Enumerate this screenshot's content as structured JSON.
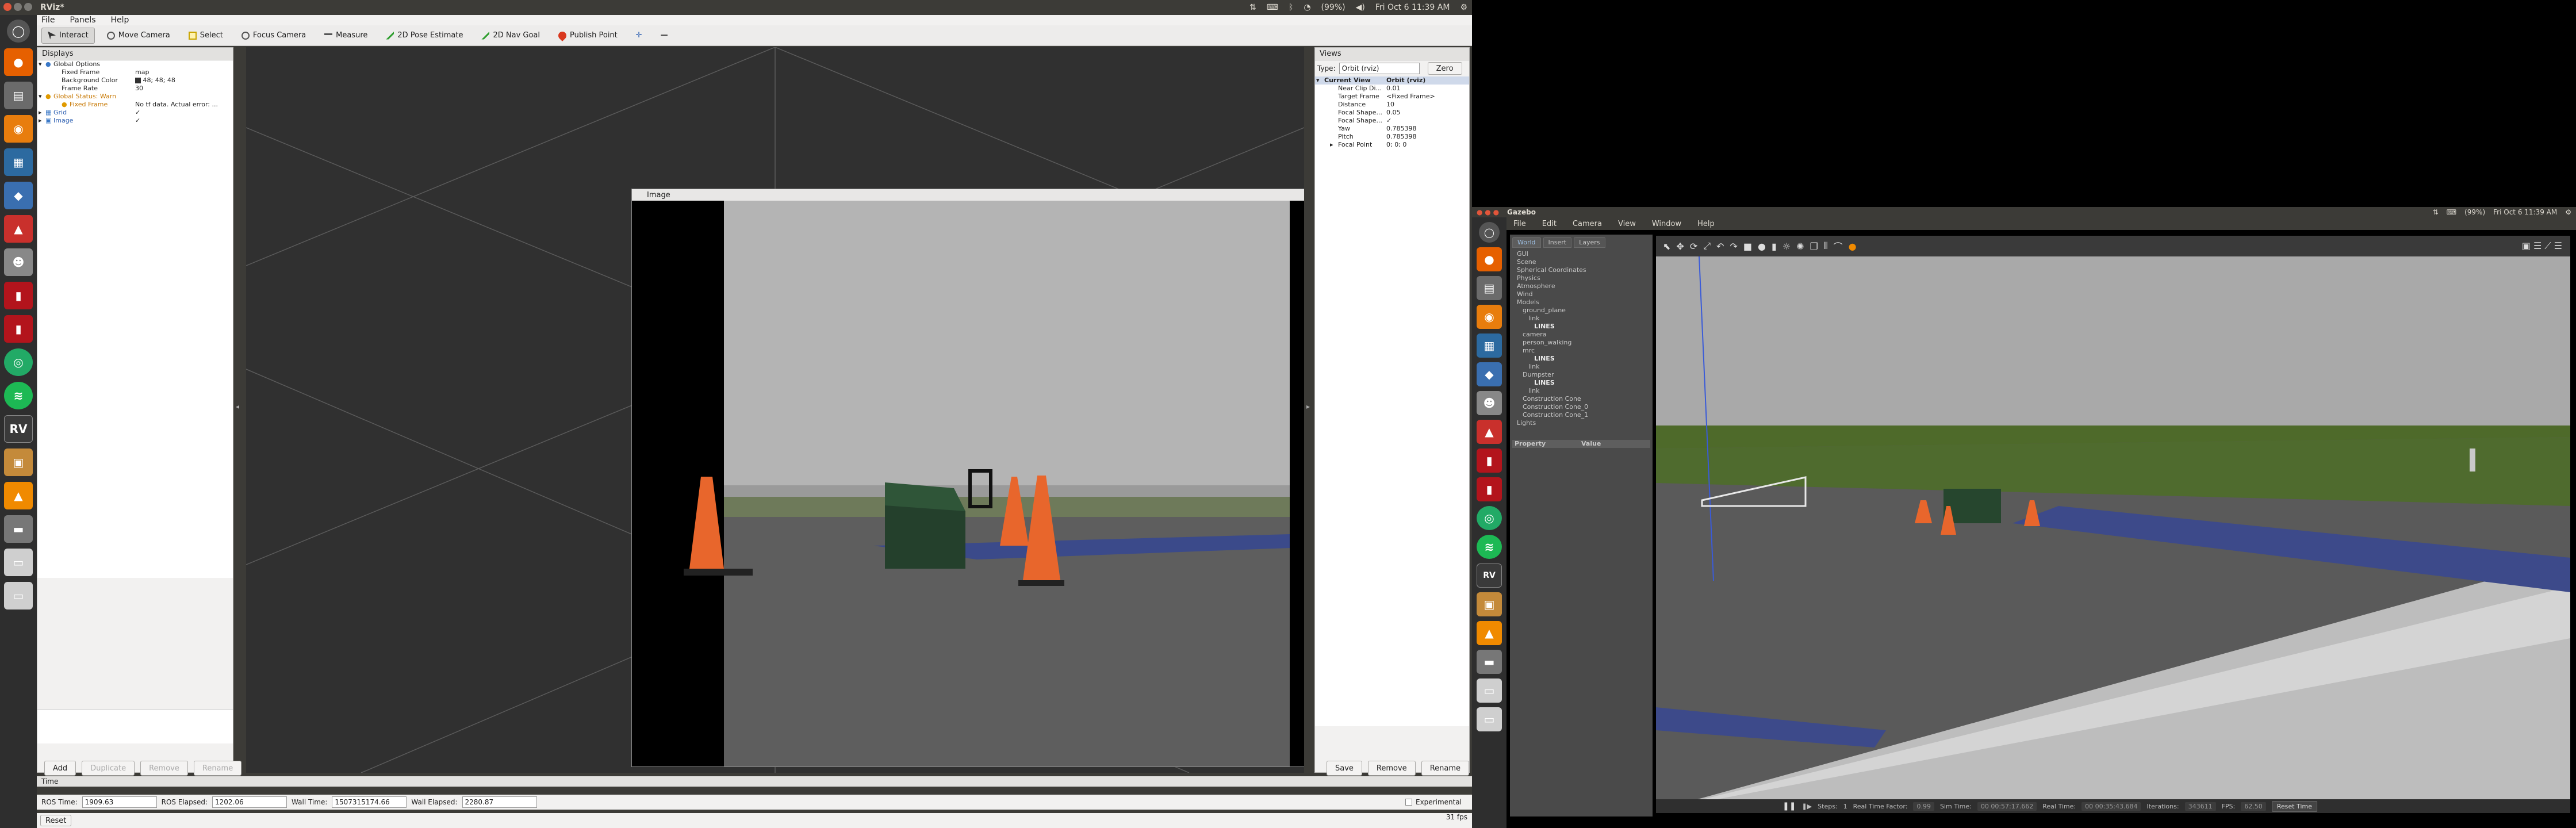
{
  "top_left": {
    "app_title": "RViz*",
    "tray": {
      "battery": "(99%)",
      "clock": "Fri Oct  6 11:39 AM"
    }
  },
  "menu": [
    "File",
    "Panels",
    "Help"
  ],
  "toolbar": [
    "Interact",
    "Move Camera",
    "Select",
    "Focus Camera",
    "Measure",
    "2D Pose Estimate",
    "2D Nav Goal",
    "Publish Point"
  ],
  "displays": {
    "title": "Displays",
    "rows": [
      {
        "label": "Global Options",
        "value": ""
      },
      {
        "label": "Fixed Frame",
        "value": "map"
      },
      {
        "label": "Background Color",
        "value": "48; 48; 48"
      },
      {
        "label": "Frame Rate",
        "value": "30"
      },
      {
        "label": "Global Status: Warn",
        "value": ""
      },
      {
        "label": "Fixed Frame",
        "value": "No tf data.  Actual error: ..."
      },
      {
        "label": "Grid",
        "value": "✓"
      },
      {
        "label": "Image",
        "value": "✓"
      }
    ],
    "buttons": [
      "Add",
      "Duplicate",
      "Remove",
      "Rename"
    ]
  },
  "image_window": {
    "title": "Image"
  },
  "views": {
    "title": "Views",
    "type_label": "Type:",
    "type_value": "Orbit (rviz)",
    "zero": "Zero",
    "rows": [
      {
        "label": "Current View",
        "value": "Orbit (rviz)"
      },
      {
        "label": "Near Clip Di...",
        "value": "0.01"
      },
      {
        "label": "Target Frame",
        "value": "<Fixed Frame>"
      },
      {
        "label": "Distance",
        "value": "10"
      },
      {
        "label": "Focal Shape...",
        "value": "0.05"
      },
      {
        "label": "Focal Shape...",
        "value": "✓"
      },
      {
        "label": "Yaw",
        "value": "0.785398"
      },
      {
        "label": "Pitch",
        "value": "0.785398"
      },
      {
        "label": "Focal Point",
        "value": "0; 0; 0"
      }
    ],
    "buttons": [
      "Save",
      "Remove",
      "Rename"
    ]
  },
  "time": {
    "title": "Time",
    "ros_time_label": "ROS Time:",
    "ros_time": "1909.63",
    "ros_elapsed_label": "ROS Elapsed:",
    "ros_elapsed": "1202.06",
    "wall_time_label": "Wall Time:",
    "wall_time": "1507315174.66",
    "wall_elapsed_label": "Wall Elapsed:",
    "wall_elapsed": "2280.87",
    "experimental": "Experimental",
    "reset": "Reset",
    "fps": "31 fps"
  },
  "gazebo": {
    "title": "Gazebo",
    "tray": {
      "battery": "(99%)",
      "clock": "Fri Oct  6 11:39 AM"
    },
    "menu": [
      "File",
      "Edit",
      "Camera",
      "View",
      "Window",
      "Help"
    ],
    "tabs": [
      "World",
      "Insert",
      "Layers"
    ],
    "tree": [
      {
        "label": "GUI",
        "indent": 0
      },
      {
        "label": "Scene",
        "indent": 0
      },
      {
        "label": "Spherical Coordinates",
        "indent": 0
      },
      {
        "label": "Physics",
        "indent": 0
      },
      {
        "label": "Atmosphere",
        "indent": 0
      },
      {
        "label": "Wind",
        "indent": 0
      },
      {
        "label": "Models",
        "indent": 0
      },
      {
        "label": "ground_plane",
        "indent": 1
      },
      {
        "label": "link",
        "indent": 2
      },
      {
        "label": "LINES",
        "indent": 3
      },
      {
        "label": "camera",
        "indent": 1
      },
      {
        "label": "person_walking",
        "indent": 1
      },
      {
        "label": "mrc",
        "indent": 1
      },
      {
        "label": "LINES",
        "indent": 3
      },
      {
        "label": "link",
        "indent": 2
      },
      {
        "label": "Dumpster",
        "indent": 1
      },
      {
        "label": "LINES",
        "indent": 3
      },
      {
        "label": "link",
        "indent": 2
      },
      {
        "label": "Construction Cone",
        "indent": 1
      },
      {
        "label": "Construction Cone_0",
        "indent": 1
      },
      {
        "label": "Construction Cone_1",
        "indent": 1
      },
      {
        "label": "Lights",
        "indent": 0
      }
    ],
    "prop_header": {
      "property": "Property",
      "value": "Value"
    },
    "bottom": {
      "steps_label": "Steps:",
      "steps": "1",
      "rtf_label": "Real Time Factor:",
      "rtf": "0.99",
      "sim_label": "Sim Time:",
      "sim": "00 00:57:17.662",
      "real_label": "Real Time:",
      "real": "00 00:35:43.684",
      "iter_label": "Iterations:",
      "iter": "343611",
      "fps_label": "FPS:",
      "fps": "62.50",
      "reset": "Reset Time"
    }
  }
}
